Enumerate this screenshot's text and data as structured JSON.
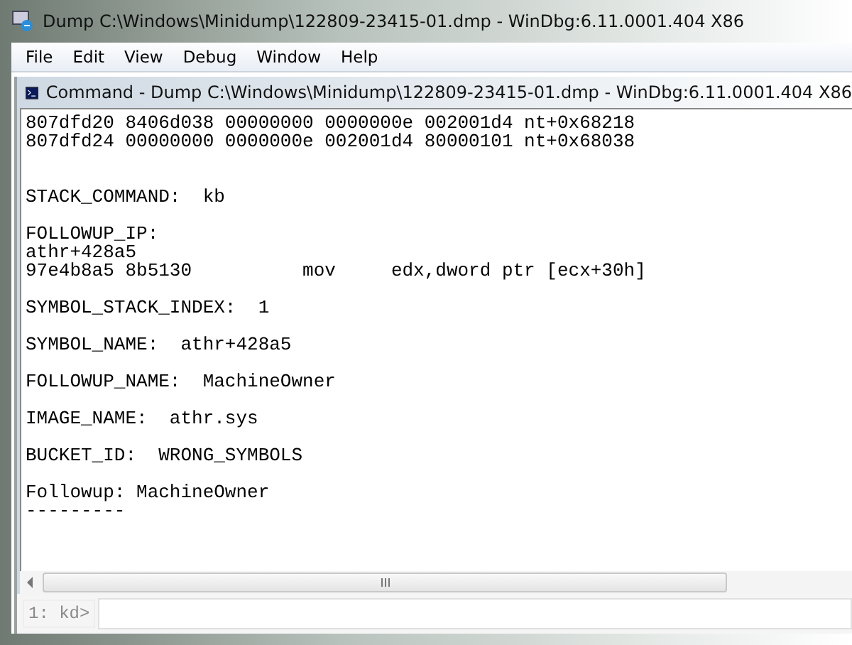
{
  "window": {
    "title": "Dump C:\\Windows\\Minidump\\122809-23415-01.dmp - WinDbg:6.11.0001.404 X86"
  },
  "menu": [
    "File",
    "Edit",
    "View",
    "Debug",
    "Window",
    "Help"
  ],
  "child_window": {
    "title": "Command - Dump C:\\Windows\\Minidump\\122809-23415-01.dmp - WinDbg:6.11.0001.404 X86"
  },
  "output_blocks": [
    [
      "807dfd20 8406d038 00000000 0000000e 002001d4 nt+0x68218",
      "807dfd24 00000000 0000000e 002001d4 80000101 nt+0x68038"
    ],
    [
      "STACK_COMMAND:  kb"
    ],
    [
      "FOLLOWUP_IP:",
      "athr+428a5",
      "97e4b8a5 8b5130          mov     edx,dword ptr [ecx+30h]"
    ],
    [
      "SYMBOL_STACK_INDEX:  1"
    ],
    [
      "SYMBOL_NAME:  athr+428a5"
    ],
    [
      "FOLLOWUP_NAME:  MachineOwner"
    ],
    [
      "IMAGE_NAME:  athr.sys"
    ],
    [
      "BUCKET_ID:  WRONG_SYMBOLS"
    ],
    [
      "Followup: MachineOwner",
      "---------"
    ]
  ],
  "prompt": {
    "label": "1: kd>",
    "disabled": true
  }
}
